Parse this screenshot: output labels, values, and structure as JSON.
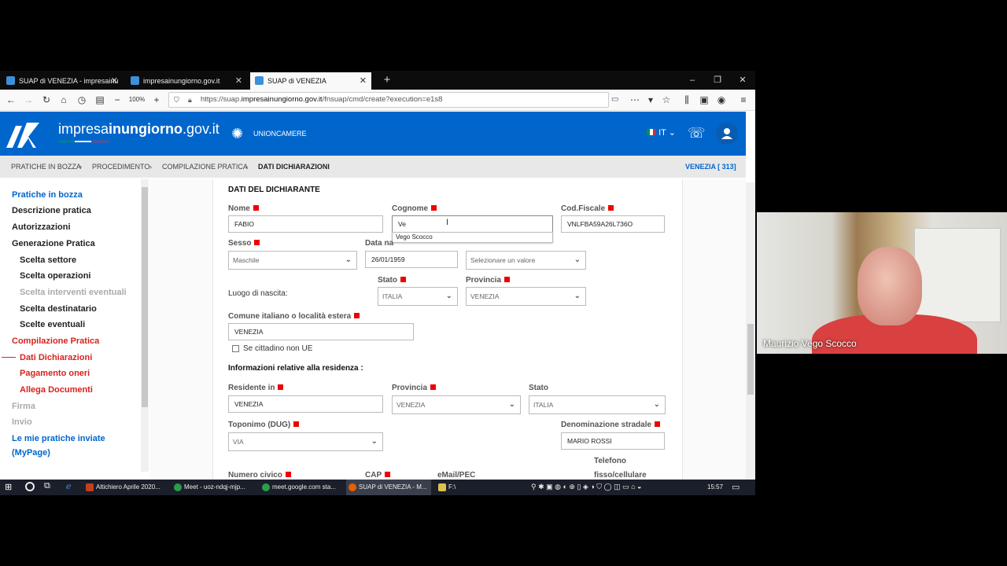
{
  "browser": {
    "tabs": [
      {
        "label": "SUAP di VENEZIA - impresainu",
        "active": false
      },
      {
        "label": "impresainungiorno.gov.it",
        "active": false
      },
      {
        "label": "SUAP di VENEZIA",
        "active": true
      }
    ],
    "zoom": "100%",
    "url_prefix": "https://suap.",
    "url_host": "impresainungiorno.gov.it",
    "url_path": "/fnsuap/cmd/create?execution=e1s8"
  },
  "site": {
    "name_light": "impresa",
    "name_bold": "inun",
    "name_bold2": "giorno",
    "name_tail": ".gov.it",
    "partner": "UNIONCAMERE",
    "lang": "IT"
  },
  "breadcrumb": {
    "items": [
      "PRATICHE IN BOZZA",
      "PROCEDIMENTO",
      "COMPILAZIONE PRATICA",
      "DATI DICHIARAZIONI"
    ],
    "right": "VENEZIA [ 313]"
  },
  "sidebar": {
    "items": [
      {
        "label": "Pratiche in bozza"
      },
      {
        "label": "Descrizione pratica"
      },
      {
        "label": "Autorizzazioni"
      },
      {
        "label": "Generazione Pratica"
      },
      {
        "label": "Scelta settore"
      },
      {
        "label": "Scelta operazioni"
      },
      {
        "label": "Scelta interventi eventuali"
      },
      {
        "label": "Scelta destinatario"
      },
      {
        "label": "Scelte eventuali"
      },
      {
        "label": "Compilazione Pratica"
      },
      {
        "label": "Dati Dichiarazioni"
      },
      {
        "label": "Pagamento oneri"
      },
      {
        "label": "Allega Documenti"
      },
      {
        "label": "Firma"
      },
      {
        "label": "Invio"
      },
      {
        "label": "Le mie pratiche inviate"
      },
      {
        "label": "(MyPage)"
      }
    ]
  },
  "form": {
    "section_title": "DATI DEL DICHIARANTE",
    "nome_label": "Nome",
    "nome_value": "FABIO",
    "cognome_label": "Cognome",
    "cognome_value": "Ve",
    "cognome_suggestion": "Vego Scocco",
    "codfiscale_label": "Cod.Fiscale",
    "codfiscale_value": "VNLFBA59A26L736O",
    "sesso_label": "Sesso",
    "sesso_value": "Maschile",
    "datanascita_label": "Data na",
    "datanascita_value": "26/01/1959",
    "extra_select_value": "Selezionare un valore",
    "luogo_label": "Luogo di nascita:",
    "stato_label": "Stato",
    "stato_value": "ITALIA",
    "provincia_label": "Provincia",
    "provincia_value": "VENEZIA",
    "comune_label": "Comune italiano o località estera",
    "comune_value": "VENEZIA",
    "non_ue_label": "Se cittadino non UE",
    "residenza_title": "Informazioni relative alla residenza :",
    "residente_label": "Residente in",
    "residente_value": "VENEZIA",
    "res_provincia_label": "Provincia",
    "res_provincia_value": "VENEZIA",
    "res_stato_label": "Stato",
    "res_stato_value": "ITALIA",
    "toponimo_label": "Toponimo (DUG)",
    "toponimo_value": "VIA",
    "denominazione_label": "Denominazione stradale",
    "denominazione_value": "MARIO ROSSI",
    "telefono_label_1": "Telefono",
    "telefono_label_2": "fisso/cellulare",
    "civico_label": "Numero civico",
    "cap_label": "CAP",
    "email_label": "eMail/PEC"
  },
  "taskbar": {
    "items": [
      {
        "label": "Altichiero Aprile 2020...",
        "color": "#c43e1c"
      },
      {
        "label": "Meet - uoz-ndqj-mjp...",
        "color": "#2a9d4a"
      },
      {
        "label": "meet.google.com sta...",
        "color": "#2a9d4a"
      },
      {
        "label": "SUAP di VENEZIA - M...",
        "color": "#e66000"
      },
      {
        "label": "F:\\",
        "color": "#e0c050"
      }
    ],
    "time": "15:57"
  },
  "video": {
    "participant_name": "Maurizio Vego Scocco"
  },
  "colors": {
    "brand_blue": "#0066cc",
    "required_red": "#ee0000",
    "active_red": "#d8231c"
  }
}
